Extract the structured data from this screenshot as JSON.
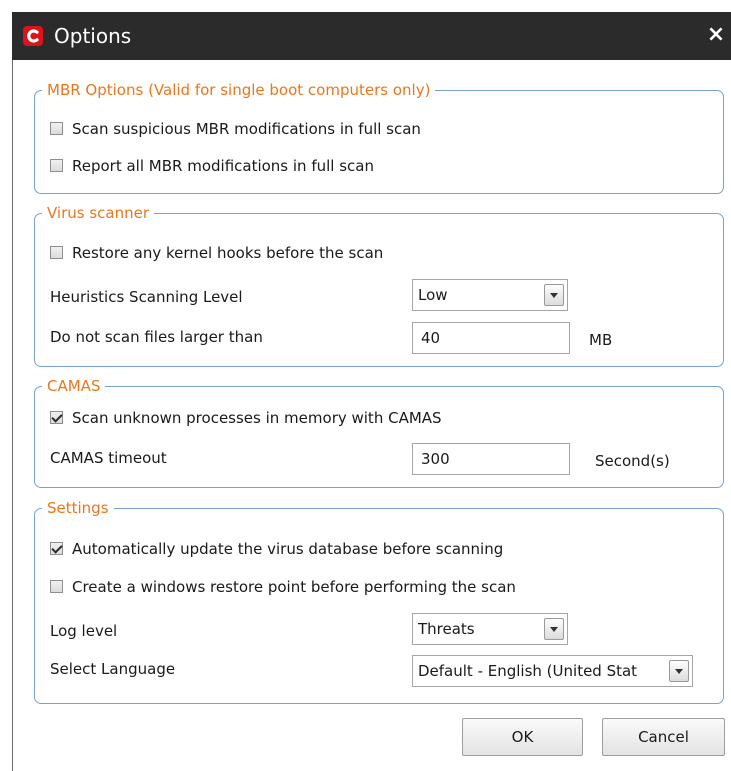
{
  "window": {
    "title": "Options",
    "close_label": "×"
  },
  "mbr": {
    "legend": "MBR Options (Valid for single boot computers only)",
    "scan_suspicious": {
      "label": "Scan suspicious MBR modifications in full scan",
      "checked": false
    },
    "report_all": {
      "label": "Report all MBR modifications in full scan",
      "checked": false
    }
  },
  "virus_scanner": {
    "legend": "Virus scanner",
    "restore_hooks": {
      "label": "Restore any kernel hooks before the scan",
      "checked": false
    },
    "heuristics_label": "Heuristics Scanning Level",
    "heuristics_value": "Low",
    "max_size_label": "Do not scan files larger than",
    "max_size_value": "40",
    "max_size_unit": "MB"
  },
  "camas": {
    "legend": "CAMAS",
    "scan_unknown": {
      "label": "Scan unknown processes in memory with CAMAS",
      "checked": true
    },
    "timeout_label": "CAMAS timeout",
    "timeout_value": "300",
    "timeout_unit": "Second(s)"
  },
  "settings": {
    "legend": "Settings",
    "auto_update": {
      "label": "Automatically update the virus database before scanning",
      "checked": true
    },
    "restore_point": {
      "label": "Create a windows restore point before performing the scan",
      "checked": false
    },
    "log_level_label": "Log level",
    "log_level_value": "Threats",
    "language_label": "Select Language",
    "language_value": "Default - English (United Stat"
  },
  "buttons": {
    "ok": "OK",
    "cancel": "Cancel"
  },
  "colors": {
    "titlebar": "#2b2b2b",
    "logo": "#d9141b",
    "legend": "#e87722",
    "group_border": "#7aa2cf"
  },
  "icons": {
    "app": "comodo-logo-icon",
    "close": "close-icon",
    "dropdown": "chevron-down-icon"
  }
}
